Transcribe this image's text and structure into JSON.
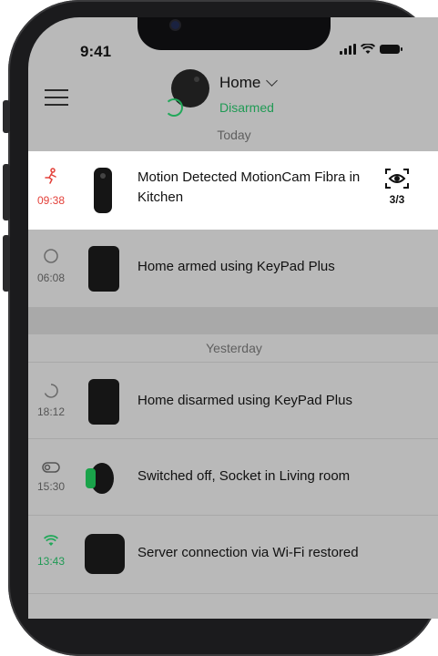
{
  "status_bar": {
    "time": "9:41"
  },
  "header": {
    "hub_name": "Home",
    "hub_status": "Disarmed"
  },
  "sections": {
    "today": "Today",
    "yesterday": "Yesterday"
  },
  "events": [
    {
      "time": "09:38",
      "text": "Motion Detected MotionCam Fibra in Kitchen",
      "photo_count": "3/3",
      "icon": "motion-icon"
    },
    {
      "time": "06:08",
      "text": "Home armed using KeyPad Plus",
      "icon": "armed-circle-icon"
    },
    {
      "time": "18:12",
      "text": "Home disarmed using KeyPad Plus",
      "icon": "disarmed-ring-icon"
    },
    {
      "time": "15:30",
      "text": "Switched off, Socket in Living room",
      "icon": "toggle-off-icon"
    },
    {
      "time": "13:43",
      "text": "Server connection via Wi-Fi restored",
      "icon": "wifi-icon"
    }
  ],
  "colors": {
    "alarm_red": "#e3413a",
    "ok_green": "#22a85a",
    "overlay_gray": "#b9b9b9"
  }
}
